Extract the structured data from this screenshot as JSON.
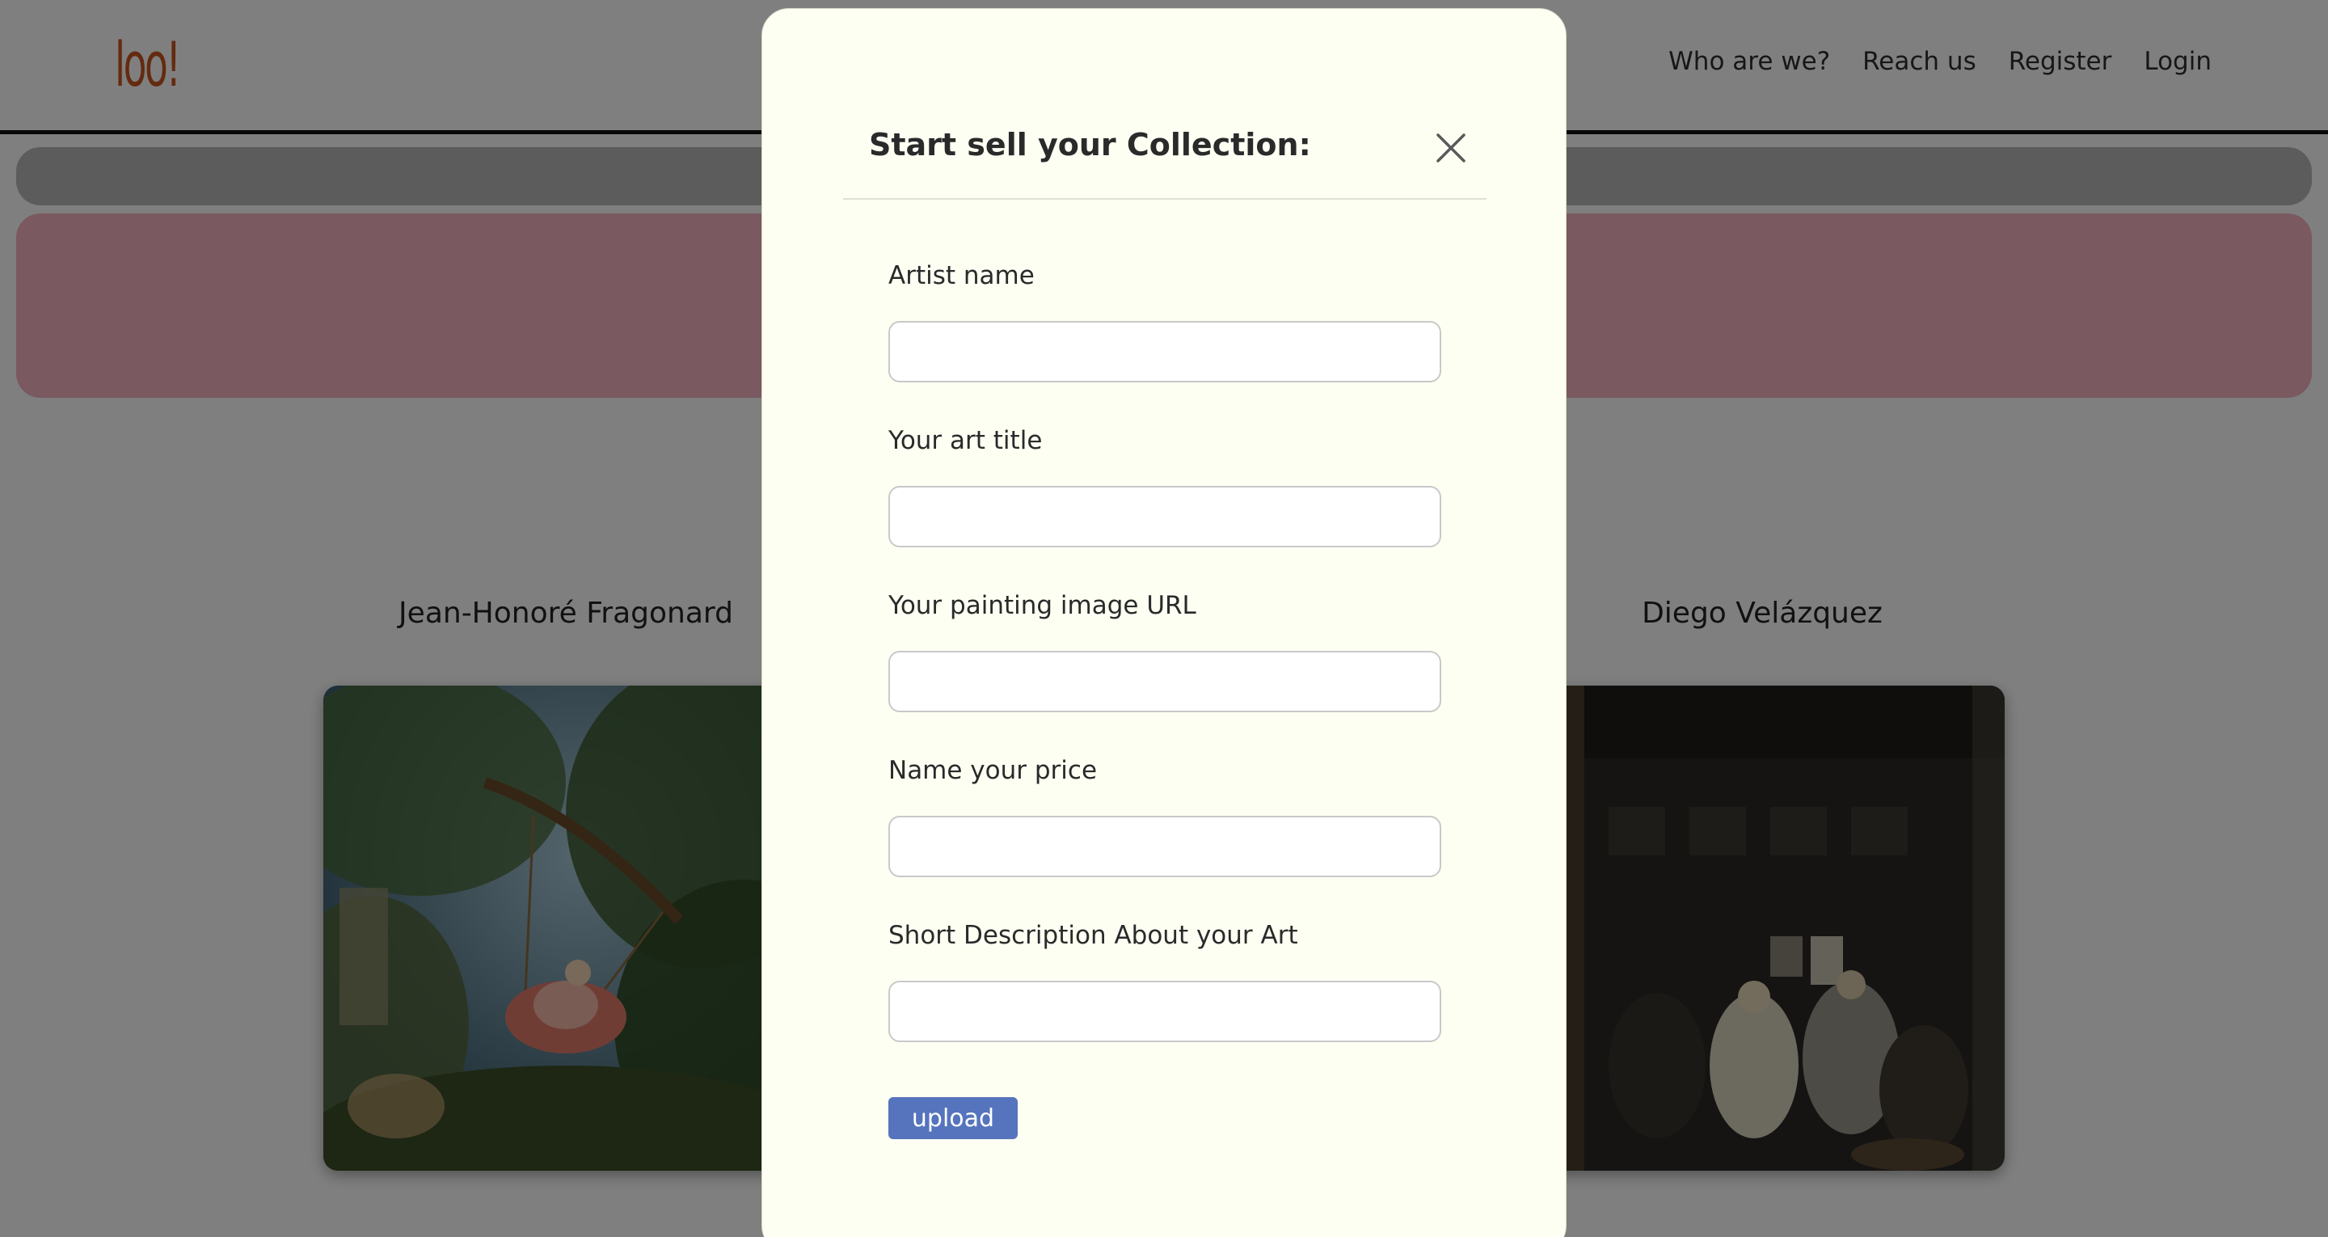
{
  "navbar": {
    "logo_text": "loo!",
    "links": [
      "Who are we?",
      "Reach us",
      "Register",
      "Login"
    ]
  },
  "gallery": {
    "artists": [
      "Jean-Honoré Fragonard",
      "Diego Velázquez"
    ]
  },
  "modal": {
    "title": "Start sell your Collection:",
    "fields": [
      {
        "label": "Artist name",
        "value": "",
        "placeholder": ""
      },
      {
        "label": "Your art title",
        "value": "",
        "placeholder": ""
      },
      {
        "label": "Your painting image URL",
        "value": "",
        "placeholder": ""
      },
      {
        "label": "Name your price",
        "value": "",
        "placeholder": ""
      },
      {
        "label": "Short Description About your Art",
        "value": "",
        "placeholder": ""
      }
    ],
    "submit_label": "upload"
  },
  "colors": {
    "logo": "#c8551f",
    "modal_background": "#fefff3",
    "upload_button": "#5574bd",
    "hero_banner": "#f4b3c0"
  },
  "icons": {
    "close": "close-icon"
  }
}
